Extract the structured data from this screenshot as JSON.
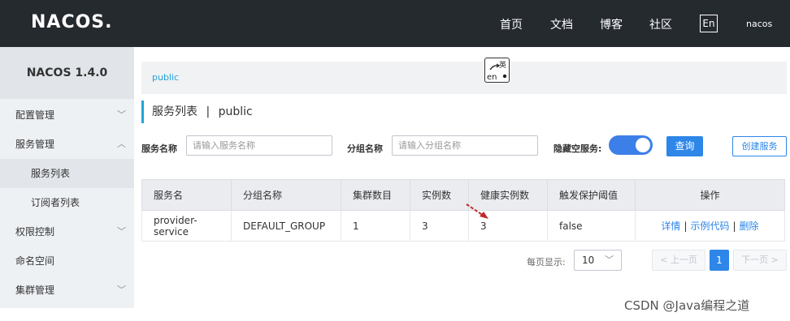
{
  "header": {
    "logo": "NACOS.",
    "nav": [
      "首页",
      "文档",
      "博客",
      "社区"
    ],
    "lang": "En",
    "user": "nacos"
  },
  "sidebar": {
    "version": "NACOS 1.4.0",
    "items": [
      {
        "label": "配置管理",
        "chevron": "⌄"
      },
      {
        "label": "服务管理",
        "chevron": "^"
      },
      {
        "label": "服务列表"
      },
      {
        "label": "订阅者列表"
      },
      {
        "label": "权限控制",
        "chevron": "⌄"
      },
      {
        "label": "命名空间"
      },
      {
        "label": "集群管理",
        "chevron": "⌄"
      }
    ]
  },
  "breadcrumb": "public",
  "page_title": {
    "main": "服务列表",
    "sep": "|",
    "ns": "public"
  },
  "filters": {
    "service_label": "服务名称",
    "service_placeholder": "请输入服务名称",
    "group_label": "分组名称",
    "group_placeholder": "请输入分组名称",
    "hide_empty_label": "隐藏空服务:",
    "hide_empty_on": true,
    "query_button": "查询",
    "create_button": "创建服务"
  },
  "table": {
    "headers": [
      "服务名",
      "分组名称",
      "集群数目",
      "实例数",
      "健康实例数",
      "触发保护阈值",
      "操作"
    ],
    "rows": [
      {
        "service": "provider-service",
        "group": "DEFAULT_GROUP",
        "clusters": "1",
        "instances": "3",
        "healthy": "3",
        "threshold": "false",
        "ops": [
          "详情",
          "示例代码",
          "删除"
        ]
      }
    ]
  },
  "pagination": {
    "per_page_label": "每页显示:",
    "per_page": "10",
    "prev": "< 上一页",
    "current": "1",
    "next": "下一页 >"
  },
  "watermark": "CSDN @Java编程之道"
}
